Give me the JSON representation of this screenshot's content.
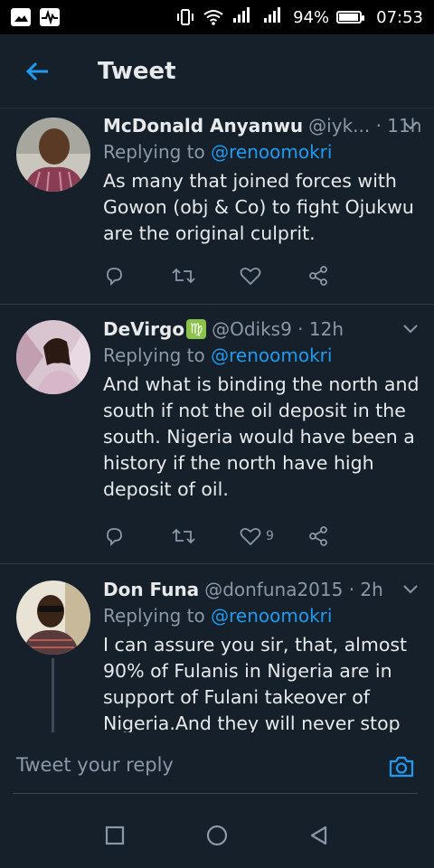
{
  "status_bar": {
    "left_icons": [
      "gallery-icon",
      "activity-icon"
    ],
    "signal_label_1": "4G",
    "signal_label_2": "G",
    "battery_percent": "94%",
    "battery_level": 0.94,
    "time": "07:53"
  },
  "header": {
    "back_icon": "arrow-left-icon",
    "title": "Tweet"
  },
  "colors": {
    "accent": "#1d9bf0",
    "background": "#15202b",
    "muted": "#8b98a5"
  },
  "tweets": [
    {
      "name": "McDonald Anyanwu",
      "handle": "@iyk...",
      "time": "11h",
      "replying_prefix": "Replying to ",
      "replying_to": "@renoomokri",
      "text": "As many that joined forces with Gowon (obj & Co) to fight Ojukwu are the original culprit.",
      "like_count": ""
    },
    {
      "name": "DeVirgo",
      "name_emoji": "♍",
      "handle": "@Odiks9",
      "time": "12h",
      "replying_prefix": "Replying to ",
      "replying_to": "@renoomokri",
      "text": "And what is binding the north and south if not the oil deposit in the south. Nigeria would have been a history if the north have high deposit of oil.",
      "like_count": "9"
    },
    {
      "name": "Don Funa",
      "handle": "@donfuna2015",
      "time": "2h",
      "replying_prefix": "Replying to ",
      "replying_to": "@renoomokri",
      "text": "I can assure you sir, that, almost 90% of Fulanis in Nigeria are in support of Fulani takeover of Nigeria.And they will never stop no",
      "like_count": ""
    }
  ],
  "reply_box": {
    "placeholder": "Tweet your reply"
  },
  "nav_bar": {
    "items": [
      "recents-square-icon",
      "home-circle-icon",
      "back-triangle-icon"
    ]
  }
}
